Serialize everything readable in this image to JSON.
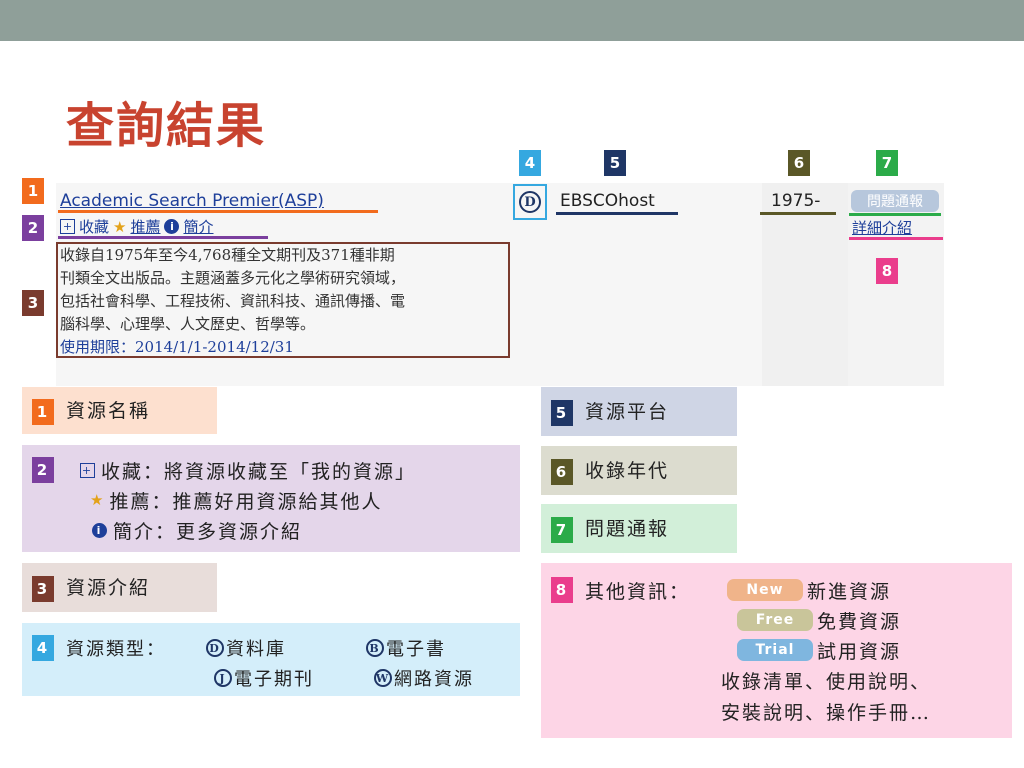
{
  "page": {
    "title": "查詢結果"
  },
  "result": {
    "resource_name": "Academic Search Premier(ASP)",
    "actions": {
      "collect": "收藏",
      "recommend": "推薦",
      "intro": "簡介"
    },
    "description_lines": [
      "收錄自1975年至今4,768種全文期刊及371種非期",
      "刊類全文出版品。主題涵蓋多元化之學術研究領域，",
      "包括社會科學、工程技術、資訊科技、通訊傳播、電",
      "腦科學、心理學、人文歷史、哲學等。"
    ],
    "usage_period": "使用期限：2014/1/1-2014/12/31",
    "type_icon_letter": "D",
    "platform": "EBSCOhost",
    "coverage_years": "1975-",
    "report_button": "問題通報",
    "detail_link": "詳細介紹"
  },
  "markers": [
    "1",
    "2",
    "3",
    "4",
    "5",
    "6",
    "7",
    "8"
  ],
  "legend": {
    "item1": {
      "num": "1",
      "label": "資源名稱"
    },
    "item2": {
      "num": "2",
      "lines": [
        "收藏：將資源收藏至「我的資源」",
        "推薦：推薦好用資源給其他人",
        "簡介：更多資源介紹"
      ]
    },
    "item3": {
      "num": "3",
      "label": "資源介紹"
    },
    "item4": {
      "num": "4",
      "label": "資源類型：",
      "types": [
        {
          "letter": "D",
          "name": "資料庫"
        },
        {
          "letter": "B",
          "name": "電子書"
        },
        {
          "letter": "J",
          "name": "電子期刊"
        },
        {
          "letter": "W",
          "name": "網路資源"
        }
      ]
    },
    "item5": {
      "num": "5",
      "label": "資源平台"
    },
    "item6": {
      "num": "6",
      "label": "收錄年代"
    },
    "item7": {
      "num": "7",
      "label": "問題通報"
    },
    "item8": {
      "num": "8",
      "label": "其他資訊：",
      "tags": [
        {
          "tag": "New",
          "text": "新進資源",
          "color": "#f0b48a"
        },
        {
          "tag": "Free",
          "text": "免費資源",
          "color": "#c9c59a"
        },
        {
          "tag": "Trial",
          "text": "試用資源",
          "color": "#7fb6df"
        }
      ],
      "extra_lines": [
        "收錄清單、使用說明、",
        "安裝說明、操作手冊…"
      ]
    }
  },
  "colors": {
    "marker1": "#f26b1d",
    "marker2": "#7b3f9e",
    "marker3": "#7a3b2e",
    "marker4": "#35a8e0",
    "marker5": "#1f3666",
    "marker6": "#5a5727",
    "marker7": "#2bab49",
    "marker8": "#ea3d8c",
    "title": "#c8432f",
    "link": "#1e3f9a"
  }
}
